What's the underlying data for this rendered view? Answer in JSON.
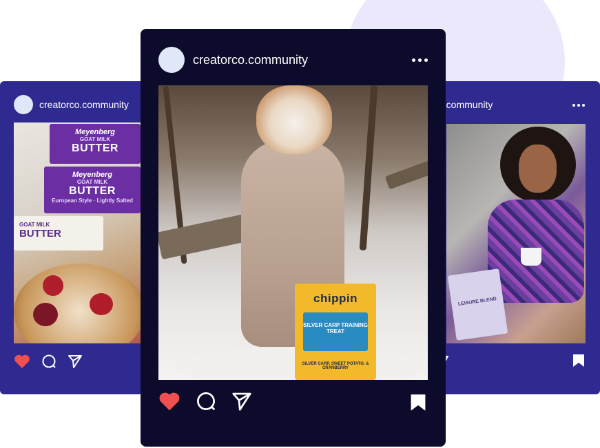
{
  "posts": {
    "left": {
      "handle": "creatorco.community",
      "product": {
        "brand": "Meyenberg",
        "line": "GOAT MILK",
        "name": "BUTTER",
        "tagline": "European Style · Lightly Salted"
      }
    },
    "center": {
      "handle": "creatorco.community",
      "product": {
        "brand": "chippin",
        "line": "SILVER CARP TRAINING TREAT",
        "sub": "SILVER CARP, SWEET POTATO, & CRANBERRY"
      }
    },
    "right": {
      "handle": "o.community",
      "product": {
        "name": "LEISURE BLEND"
      }
    }
  },
  "icons": {
    "like": "heart-icon",
    "comment": "comment-icon",
    "share": "send-icon",
    "save": "bookmark-icon",
    "more": "more-horizontal-icon"
  },
  "colors": {
    "side_card": "#2f2a8f",
    "center_card": "#0d0b2b",
    "heart": "#f0504f",
    "blob": "#ece8fb",
    "avatar": "#dfe7f8"
  }
}
